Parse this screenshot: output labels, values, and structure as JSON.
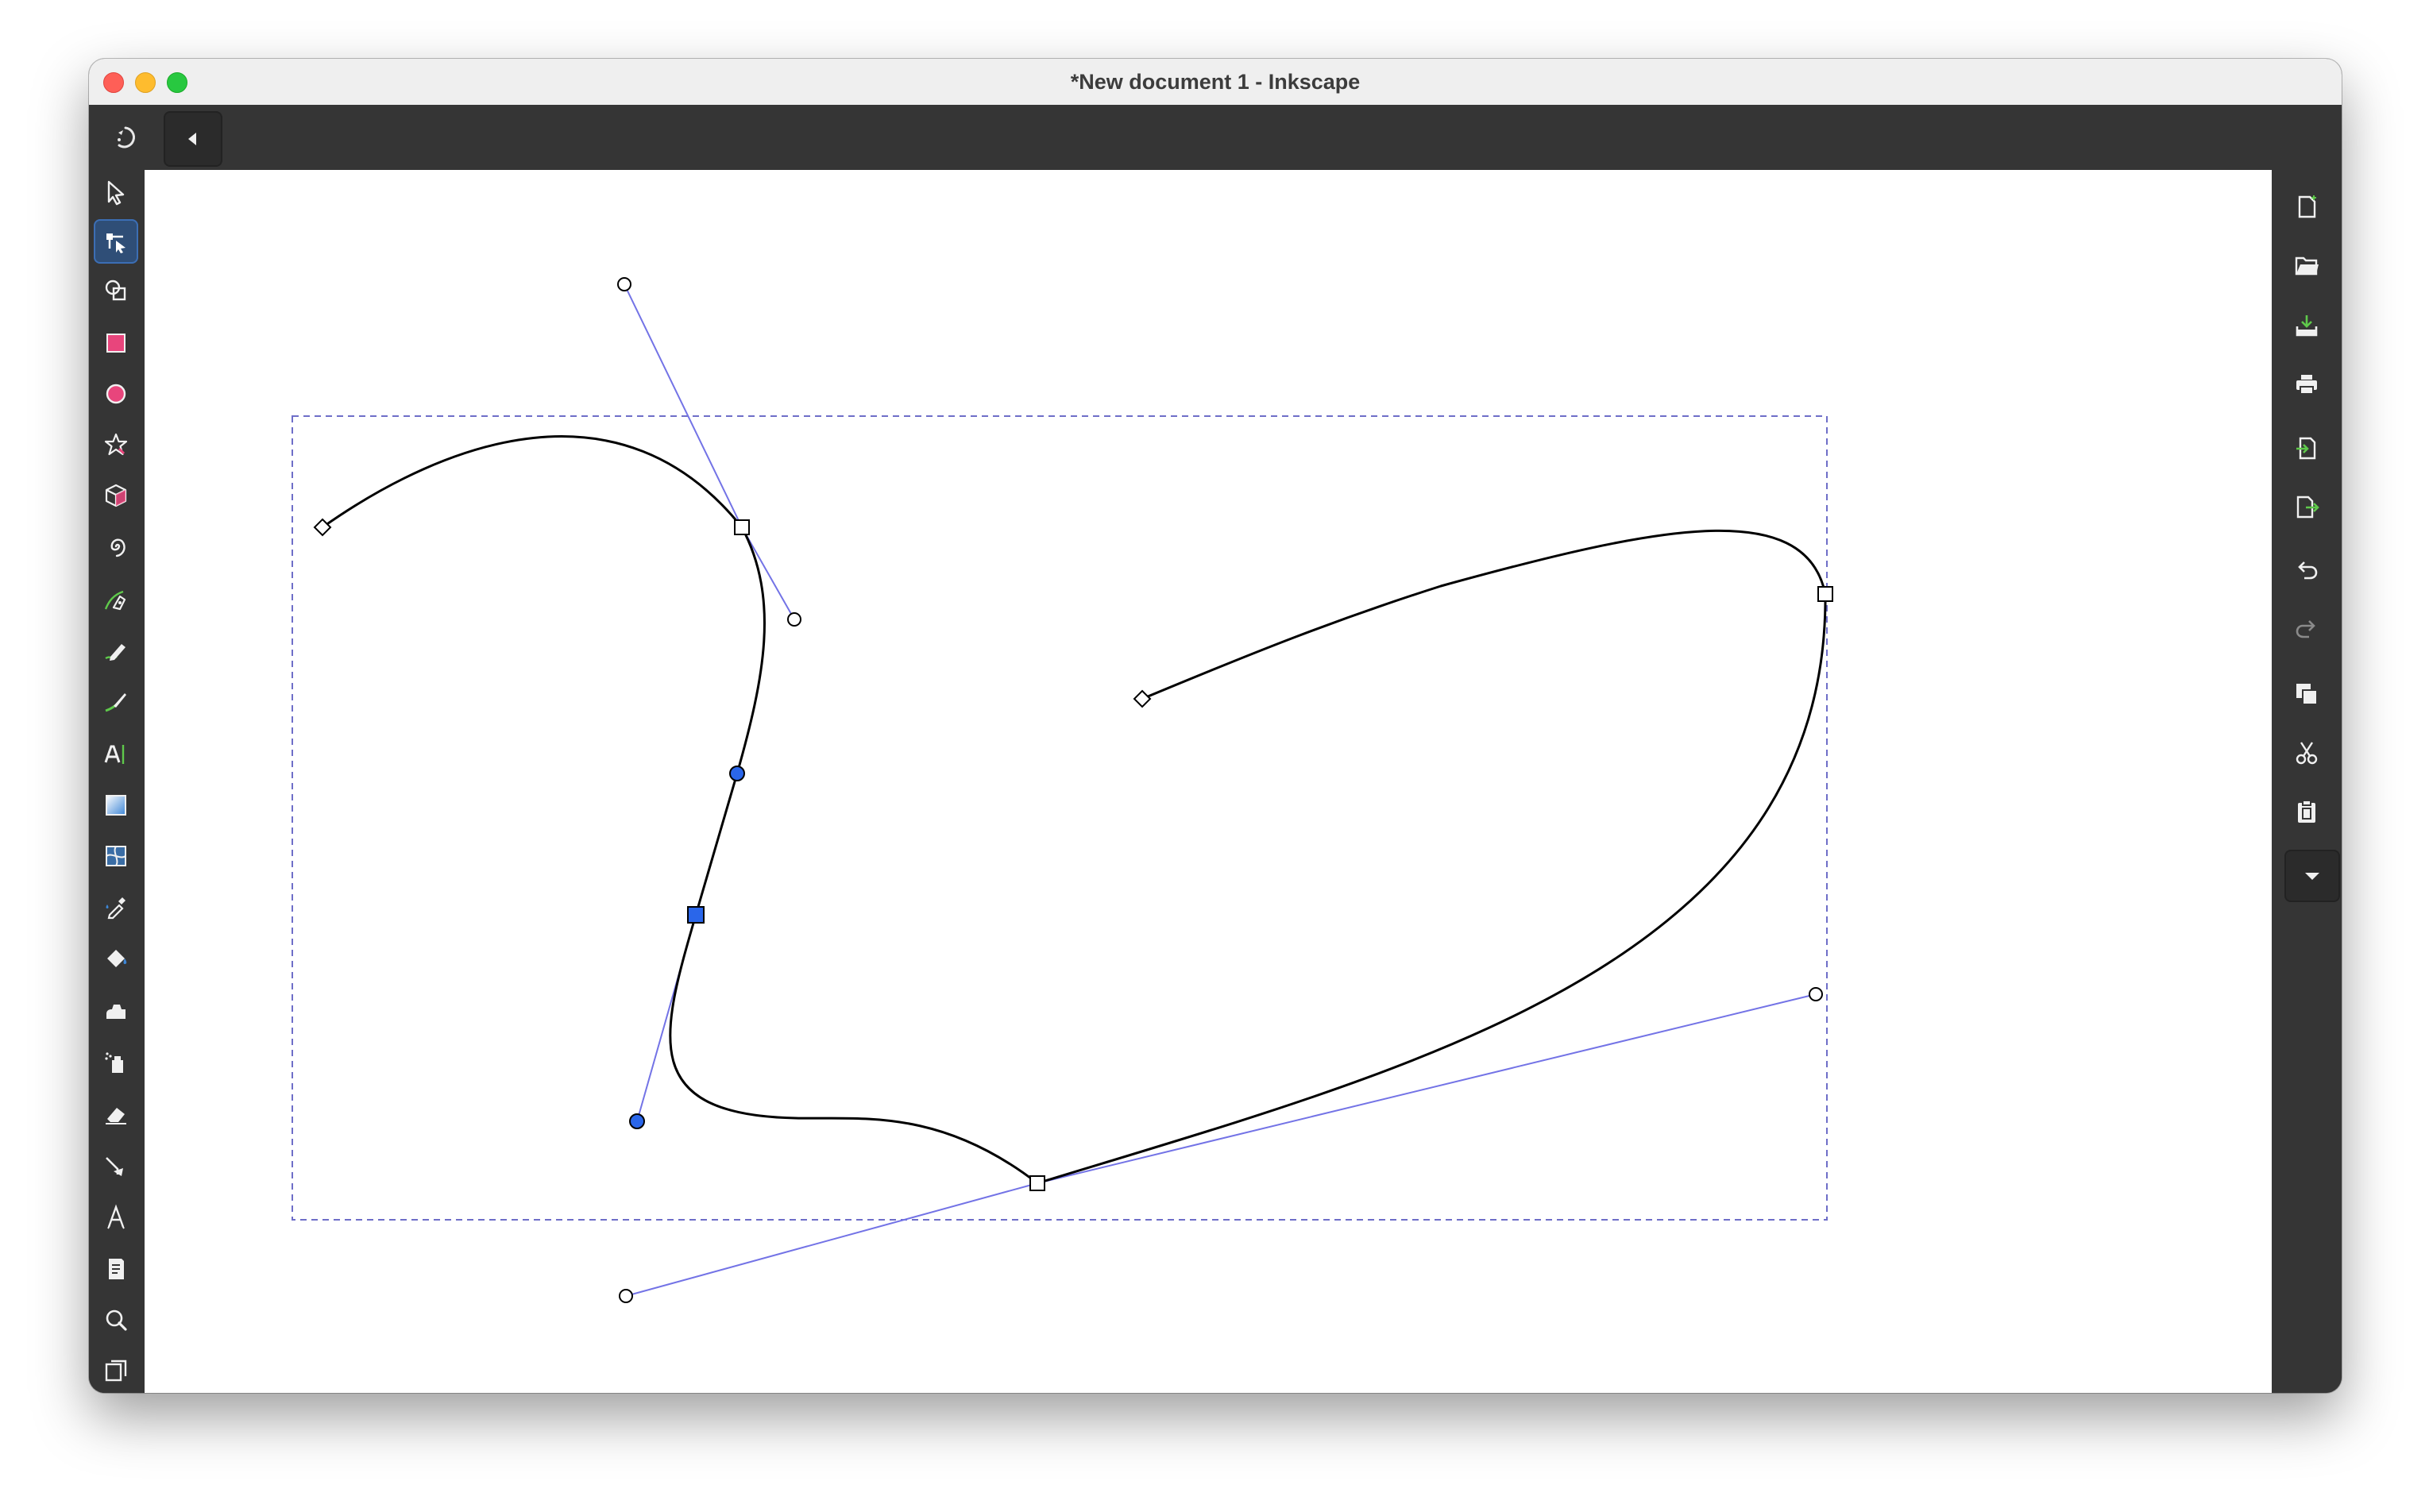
{
  "window": {
    "title": "*New document 1 - Inkscape"
  },
  "topbar": {
    "buttons": [
      {
        "icon": "rotate-icon",
        "label": "Canvas rotation"
      },
      {
        "icon": "chevron-left-icon",
        "label": "Collapse"
      }
    ]
  },
  "toolbox": {
    "active_tool": "node-tool",
    "tools": [
      "selector-icon",
      "node-icon",
      "shape-builder-icon",
      "rectangle-icon",
      "ellipse-icon",
      "star-icon",
      "box3d-icon",
      "spiral-icon",
      "pen-icon",
      "pencil-icon",
      "calligraphy-icon",
      "text-icon",
      "gradient-icon",
      "mesh-icon",
      "dropper-icon",
      "paint-bucket-icon",
      "tweak-icon",
      "spray-icon",
      "eraser-icon",
      "connector-icon",
      "measure-icon",
      "pages-icon",
      "zoom-icon",
      "lpe-icon"
    ]
  },
  "commands": {
    "items": [
      "new-document-icon",
      "open-icon",
      "save-icon",
      "print-icon",
      "import-icon",
      "export-icon",
      "undo-icon",
      "redo-icon",
      "duplicate-icon",
      "cut-icon",
      "paste-icon"
    ],
    "more": "chevron-down-icon"
  },
  "colors": {
    "path_stroke": "#000000",
    "handle_line": "#7373e6",
    "selected_node": "#2a66ea",
    "bbox_dash": "#6e6ec8",
    "active_tool_bg": "#2f4e77",
    "ui_dark": "#353535"
  }
}
